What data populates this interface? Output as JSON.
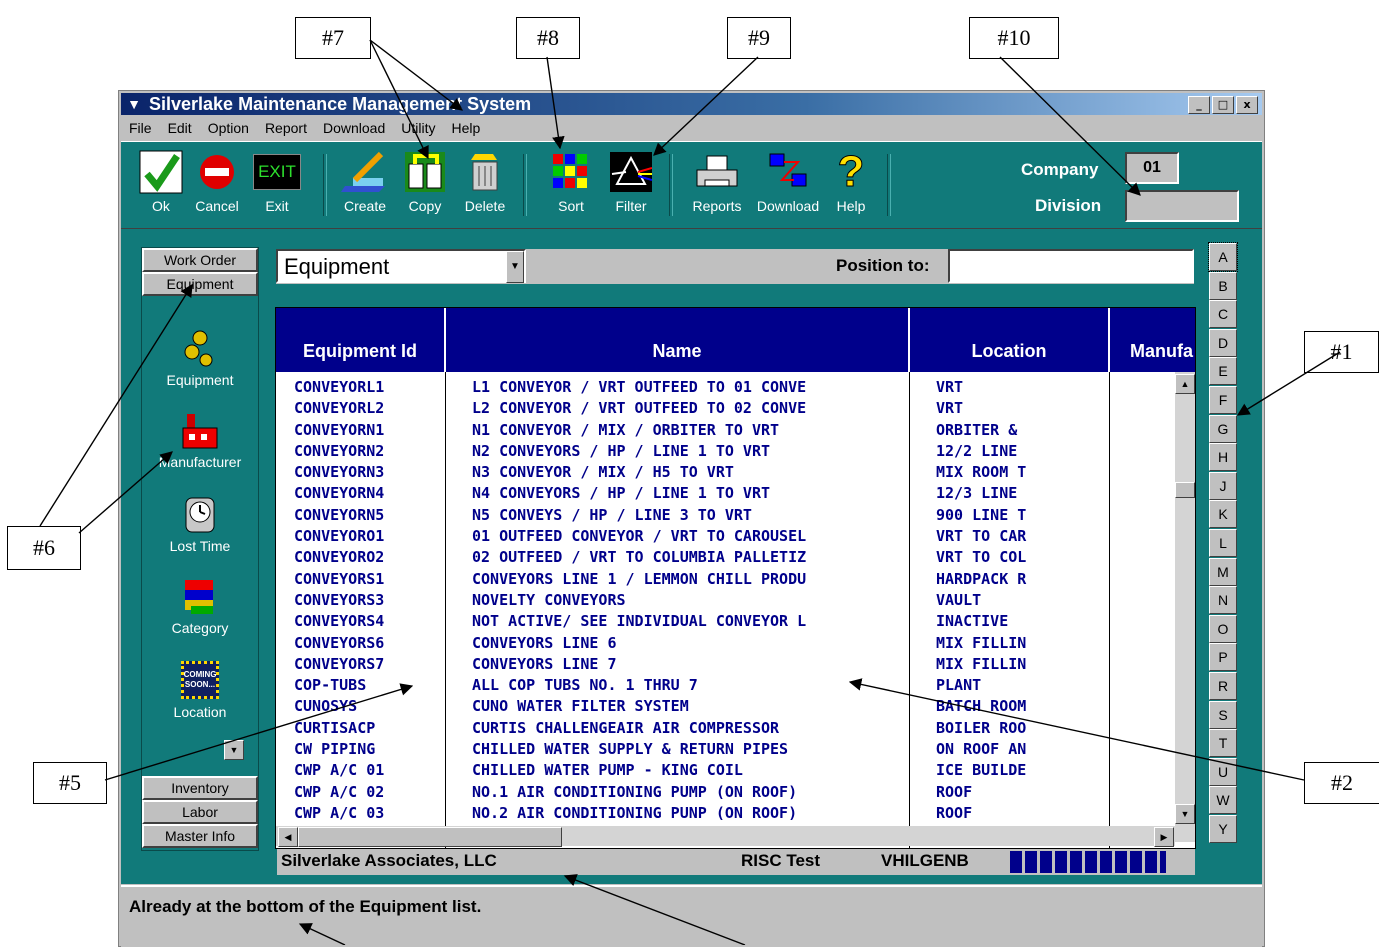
{
  "callouts": {
    "c7": "#7",
    "c8": "#8",
    "c9": "#9",
    "c10": "#10",
    "c1": "#1",
    "c6": "#6",
    "c5": "#5",
    "c2": "#2"
  },
  "window": {
    "title": "Silverlake Maintenance Management System",
    "controls": [
      "_",
      "□",
      "x"
    ]
  },
  "menu": [
    "File",
    "Edit",
    "Option",
    "Report",
    "Download",
    "Utility",
    "Help"
  ],
  "toolbar": {
    "ok": "Ok",
    "cancel": "Cancel",
    "exit": "Exit",
    "exit_icon_text": "EXIT",
    "create": "Create",
    "copy": "Copy",
    "delete": "Delete",
    "sort": "Sort",
    "filter": "Filter",
    "reports": "Reports",
    "download": "Download",
    "help": "Help"
  },
  "company": {
    "label": "Company",
    "value": "01"
  },
  "division": {
    "label": "Division",
    "value": ""
  },
  "sidebar": {
    "tabs": {
      "work_order": "Work Order",
      "equipment": "Equipment",
      "inventory": "Inventory",
      "labor": "Labor",
      "master_info": "Master Info"
    },
    "items": [
      "Equipment",
      "Manufacturer",
      "Lost Time",
      "Category",
      "Location"
    ],
    "coming_soon": "COMING SOON..."
  },
  "list": {
    "selector": "Equipment",
    "position_label": "Position to:",
    "position_value": "",
    "columns": {
      "id": "Equipment Id",
      "name": "Name",
      "location": "Location",
      "manufacturer": "Manufa"
    },
    "rows": [
      [
        "CONVEYORL1",
        "L1 CONVEYOR / VRT OUTFEED TO 01 CONVE",
        "VRT"
      ],
      [
        "CONVEYORL2",
        "L2 CONVEYOR / VRT OUTFEED TO 02 CONVE",
        "VRT"
      ],
      [
        "CONVEYORN1",
        "N1 CONVEYOR / MIX / ORBITER TO VRT",
        "ORBITER &"
      ],
      [
        "CONVEYORN2",
        "N2 CONVEYORS / HP / LINE 1 TO VRT",
        "12/2 LINE"
      ],
      [
        "CONVEYORN3",
        "N3 CONVEYOR / MIX / H5 TO VRT",
        "MIX ROOM T"
      ],
      [
        "CONVEYORN4",
        "N4 CONVEYORS / HP / LINE 1 TO VRT",
        "12/3 LINE"
      ],
      [
        "CONVEYORN5",
        "N5 CONVEYS / HP / LINE 3 TO VRT",
        "900 LINE T"
      ],
      [
        "CONVEYORO1",
        "01 OUTFEED CONVEYOR / VRT TO CAROUSEL",
        "VRT TO CAR"
      ],
      [
        "CONVEYORO2",
        "02 OUTFEED / VRT TO COLUMBIA PALLETIZ",
        "VRT TO COL"
      ],
      [
        "CONVEYORS1",
        "CONVEYORS LINE 1 / LEMMON CHILL PRODU",
        "HARDPACK R"
      ],
      [
        "CONVEYORS3",
        "NOVELTY CONVEYORS",
        "VAULT"
      ],
      [
        "CONVEYORS4",
        "NOT ACTIVE/ SEE INDIVIDUAL CONVEYOR L",
        "INACTIVE"
      ],
      [
        "CONVEYORS6",
        "CONVEYORS LINE 6",
        "MIX FILLIN"
      ],
      [
        "CONVEYORS7",
        "CONVEYORS LINE 7",
        "MIX FILLIN"
      ],
      [
        "COP-TUBS",
        "ALL COP TUBS NO. 1 THRU 7",
        "PLANT"
      ],
      [
        "CUNOSYS",
        "CUNO WATER FILTER SYSTEM",
        "BATCH ROOM"
      ],
      [
        "CURTISACP",
        "CURTIS CHALLENGEAIR AIR COMPRESSOR",
        "BOILER ROO"
      ],
      [
        "CW PIPING",
        "CHILLED WATER SUPPLY & RETURN PIPES",
        "ON ROOF AN"
      ],
      [
        "CWP A/C 01",
        "CHILLED WATER PUMP - KING COIL",
        "ICE BUILDE"
      ],
      [
        "CWP A/C 02",
        "NO.1 AIR CONDITIONING PUMP (ON ROOF)",
        "ROOF"
      ],
      [
        "CWP A/C 03",
        "NO.2 AIR CONDITIONING PUNP (ON ROOF)",
        "ROOF"
      ]
    ]
  },
  "alphabet": [
    "A",
    "B",
    "C",
    "D",
    "E",
    "F",
    "G",
    "H",
    "J",
    "K",
    "L",
    "M",
    "N",
    "O",
    "P",
    "R",
    "S",
    "T",
    "U",
    "W",
    "Y"
  ],
  "status": {
    "company": "Silverlake Associates, LLC",
    "env": "RISC Test",
    "user": "VHILGENB"
  },
  "message": "Already at the bottom of the Equipment  list."
}
